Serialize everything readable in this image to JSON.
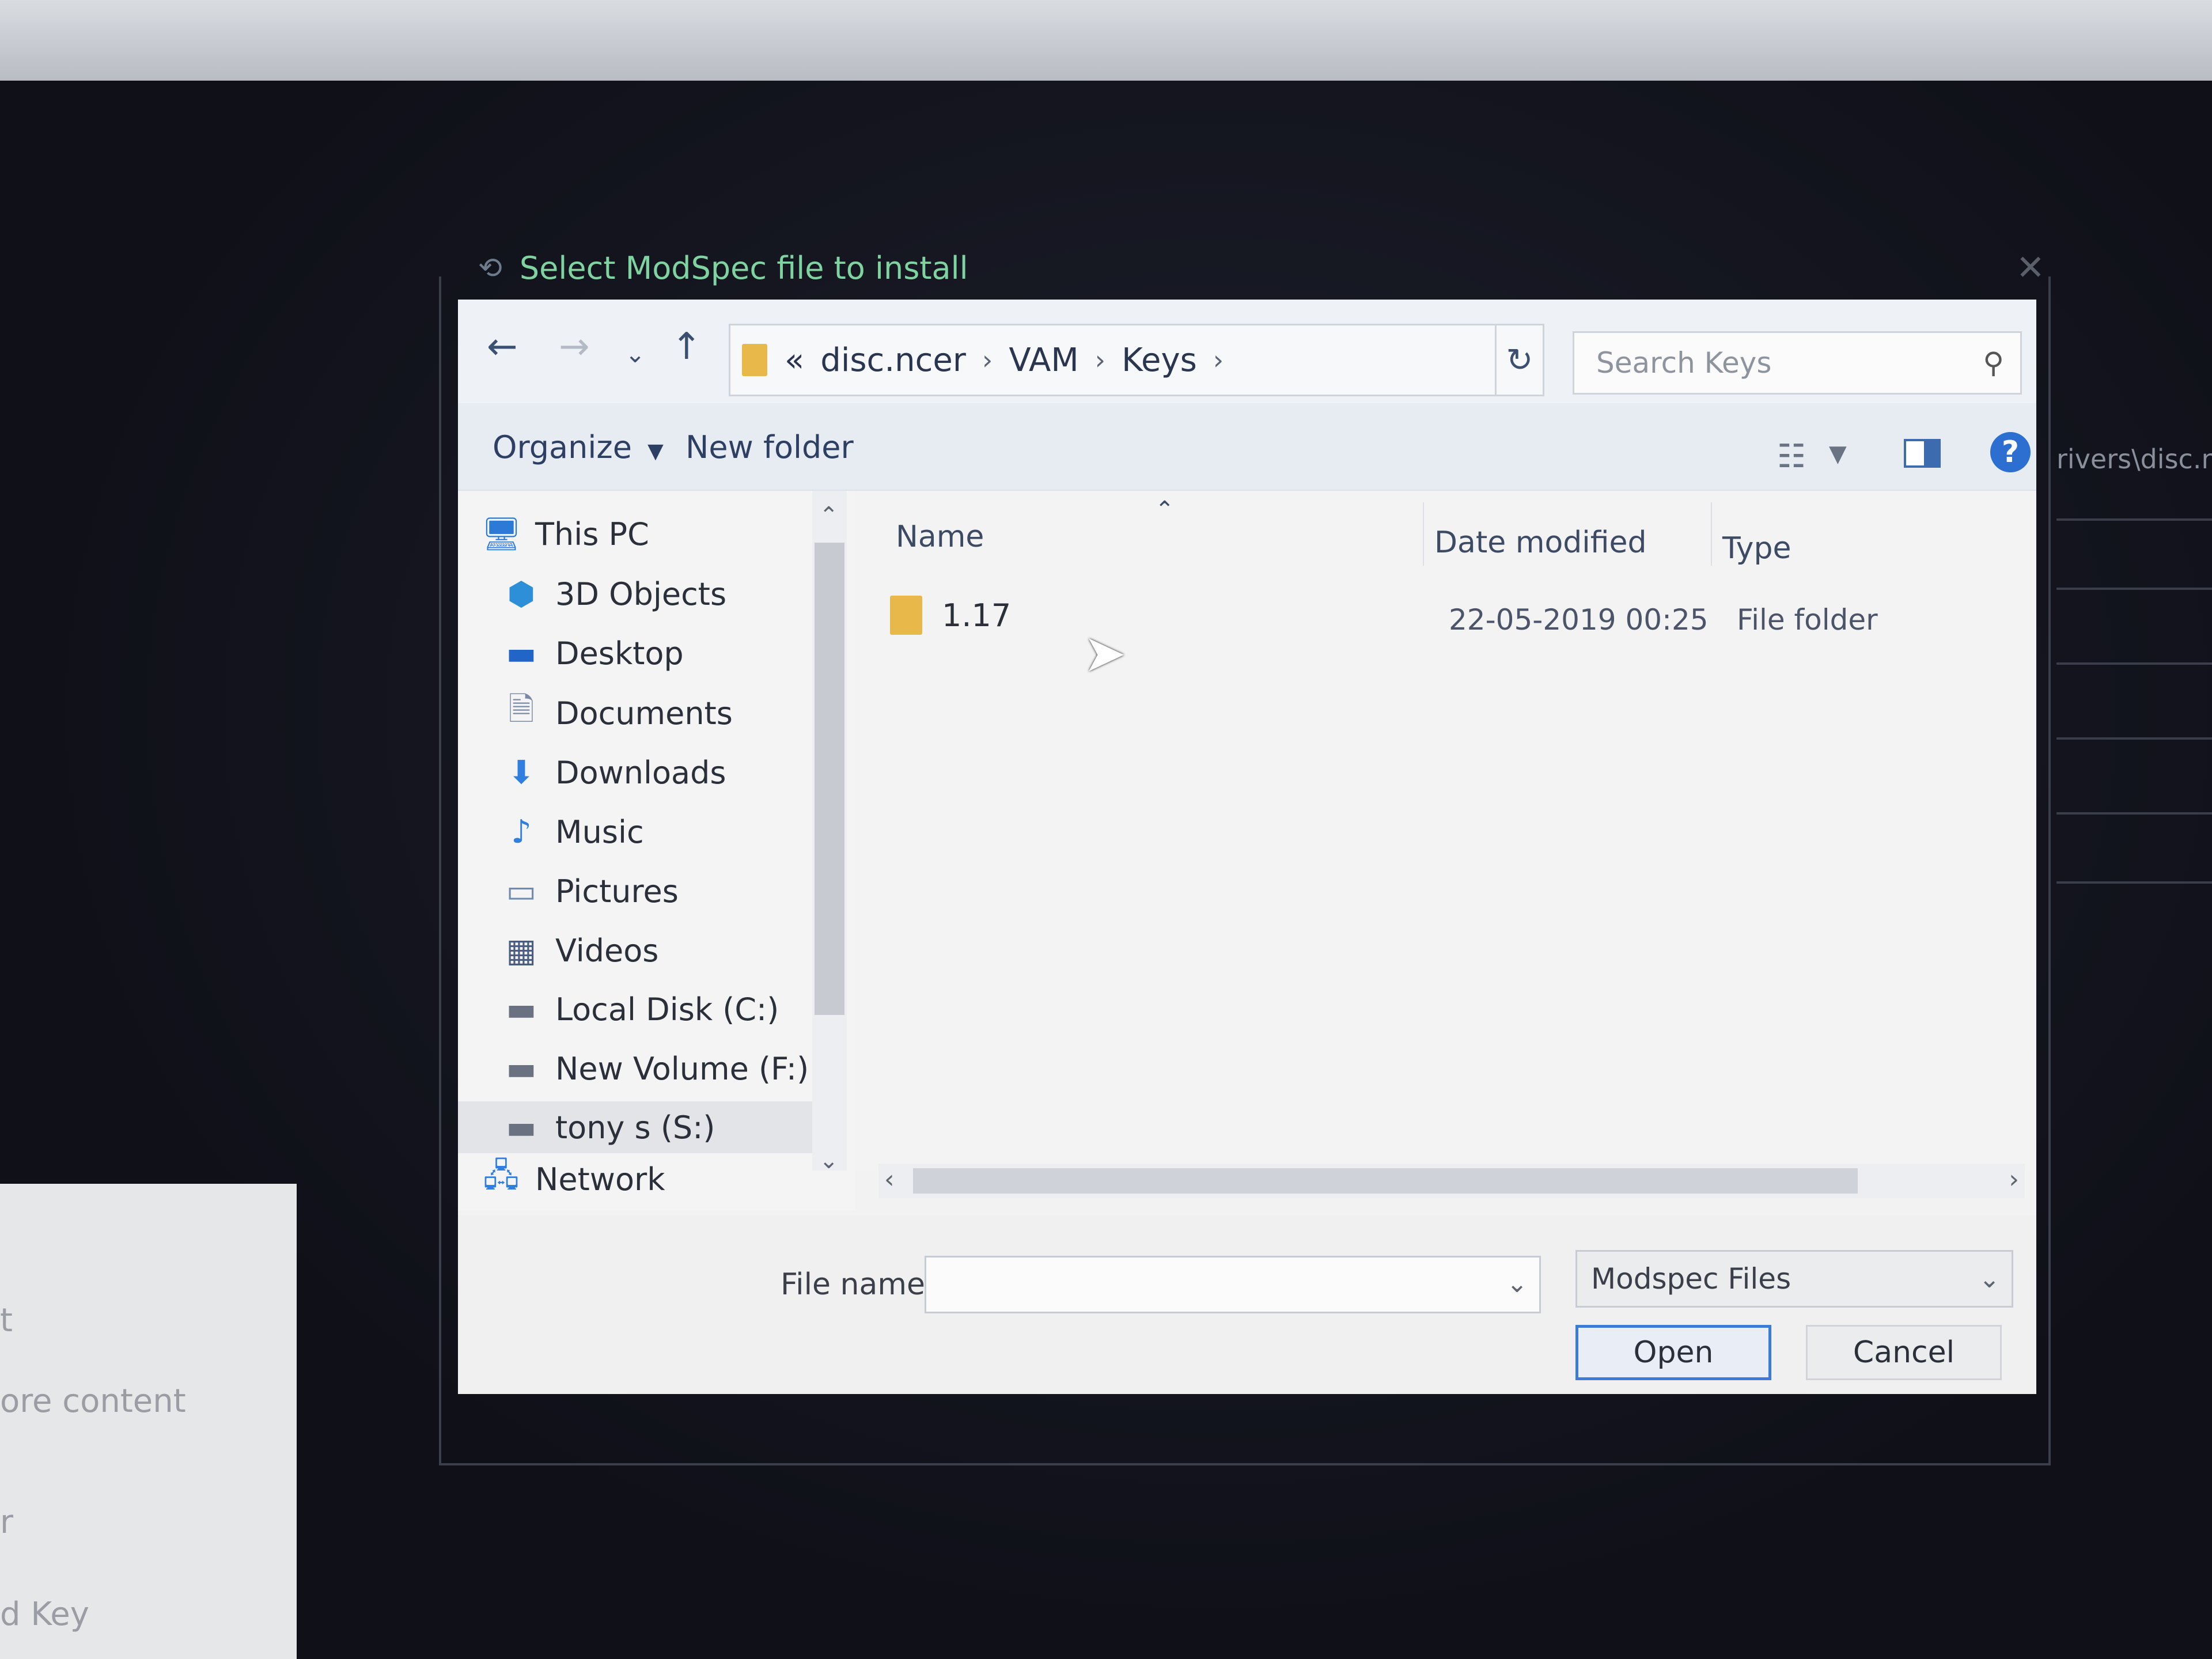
{
  "window": {
    "title": "Select ModSpec file to install"
  },
  "background": {
    "right_text": "rivers\\disc.nc",
    "left_panel_texts": [
      "t",
      "ore content",
      "r",
      "d Key"
    ]
  },
  "navigation": {
    "back_icon": "arrow-left-icon",
    "forward_icon": "arrow-right-icon",
    "recent_icon": "chevron-down-icon",
    "up_icon": "arrow-up-icon",
    "breadcrumb_overflow": "«",
    "breadcrumb": [
      "disc.ncer",
      "VAM",
      "Keys"
    ],
    "search_placeholder": "Search Keys"
  },
  "toolbar": {
    "organize_label": "Organize",
    "new_folder_label": "New folder",
    "help_label": "?"
  },
  "nav_pane": {
    "items": [
      {
        "label": "This PC",
        "icon": "pc-icon",
        "color": "#2b7bd6"
      },
      {
        "label": "3D Objects",
        "icon": "cube-icon",
        "color": "#2d8fd8"
      },
      {
        "label": "Desktop",
        "icon": "desktop-icon",
        "color": "#2166c7"
      },
      {
        "label": "Documents",
        "icon": "document-icon",
        "color": "#7a8aa6"
      },
      {
        "label": "Downloads",
        "icon": "download-icon",
        "color": "#2f7ee0"
      },
      {
        "label": "Music",
        "icon": "music-icon",
        "color": "#2f7ee0"
      },
      {
        "label": "Pictures",
        "icon": "pictures-icon",
        "color": "#6f8bb0"
      },
      {
        "label": "Videos",
        "icon": "video-icon",
        "color": "#4a5d80"
      },
      {
        "label": "Local Disk (C:)",
        "icon": "drive-icon",
        "color": "#6a7180"
      },
      {
        "label": "New Volume (F:)",
        "icon": "drive-icon",
        "color": "#6a7180"
      },
      {
        "label": "tony s (S:)",
        "icon": "drive-icon",
        "color": "#6a7180"
      },
      {
        "label": "Network",
        "icon": "network-icon",
        "color": "#2f7ee0"
      }
    ]
  },
  "file_list": {
    "columns": [
      "Name",
      "Date modified",
      "Type"
    ],
    "rows": [
      {
        "name": "1.17",
        "date_modified": "22-05-2019 00:25",
        "type": "File folder"
      }
    ]
  },
  "bottom": {
    "file_name_label": "File name:",
    "file_name_value": "",
    "filter_value": "Modspec Files",
    "open_label": "Open",
    "cancel_label": "Cancel"
  },
  "colors": {
    "title_text": "#7ed3a0",
    "accent": "#3d7bd8",
    "folder": "#e8b84a"
  }
}
